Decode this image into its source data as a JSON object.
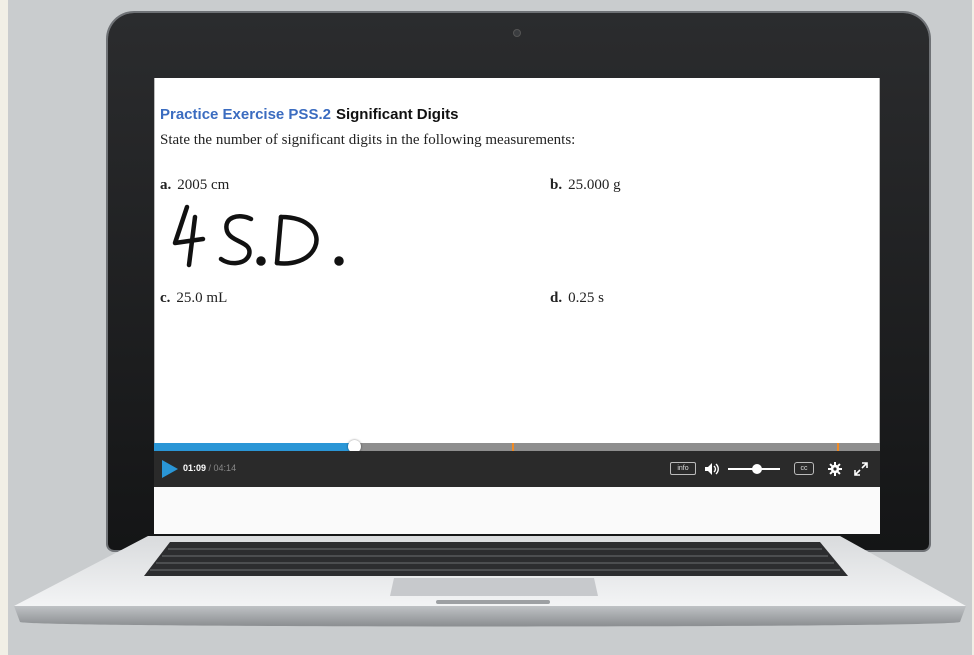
{
  "exercise": {
    "label": "Practice Exercise PSS.2",
    "title": "Significant Digits",
    "prompt": "State the number of significant digits in the following measurements:",
    "items": [
      {
        "letter": "a.",
        "value": "2005 cm"
      },
      {
        "letter": "b.",
        "value": "25.000 g"
      },
      {
        "letter": "c.",
        "value": "25.0 mL"
      },
      {
        "letter": "d.",
        "value": "0.25 s"
      }
    ],
    "handwritten_answer": "4 S.D."
  },
  "player": {
    "current_time": "01:09",
    "duration": "/ 04:14",
    "progress": 0.275,
    "volume": 0.55,
    "info_label": "info",
    "cc_label": "cc",
    "icons": {
      "play": "play-icon",
      "volume": "volume-icon",
      "settings": "gear-icon",
      "fullscreen": "fullscreen-icon"
    },
    "accent_color": "#2a96d6",
    "marker_color": "#f08a24"
  }
}
